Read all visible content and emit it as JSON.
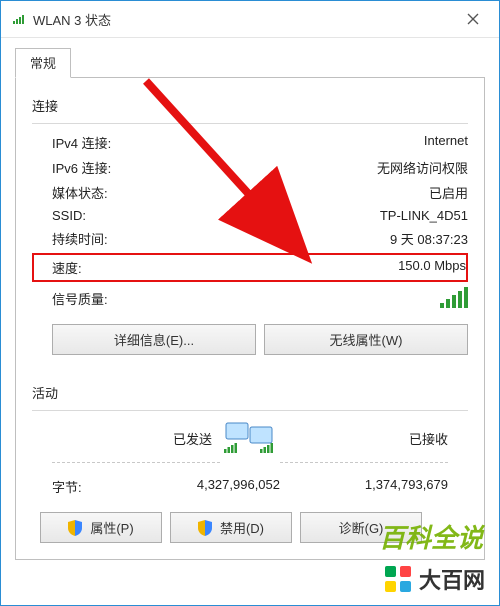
{
  "window": {
    "title": "WLAN 3 状态"
  },
  "tab": {
    "general": "常规"
  },
  "connection": {
    "heading": "连接",
    "ipv4_label": "IPv4 连接:",
    "ipv4_value": "Internet",
    "ipv6_label": "IPv6 连接:",
    "ipv6_value": "无网络访问权限",
    "media_label": "媒体状态:",
    "media_value": "已启用",
    "ssid_label": "SSID:",
    "ssid_value": "TP-LINK_4D51",
    "duration_label": "持续时间:",
    "duration_value": "9 天 08:37:23",
    "speed_label": "速度:",
    "speed_value": "150.0 Mbps",
    "signal_label": "信号质量:"
  },
  "buttons": {
    "details": "详细信息(E)...",
    "wireless_props": "无线属性(W)",
    "props": "属性(P)",
    "disable": "禁用(D)",
    "diagnose": "诊断(G)"
  },
  "activity": {
    "heading": "活动",
    "sent_label": "已发送",
    "recv_label": "已接收",
    "bytes_label": "字节:",
    "sent_value": "4,327,996,052",
    "recv_value": "1,374,793,679"
  },
  "branding": {
    "watermark": "百科全说",
    "logo_text": "大百网"
  }
}
